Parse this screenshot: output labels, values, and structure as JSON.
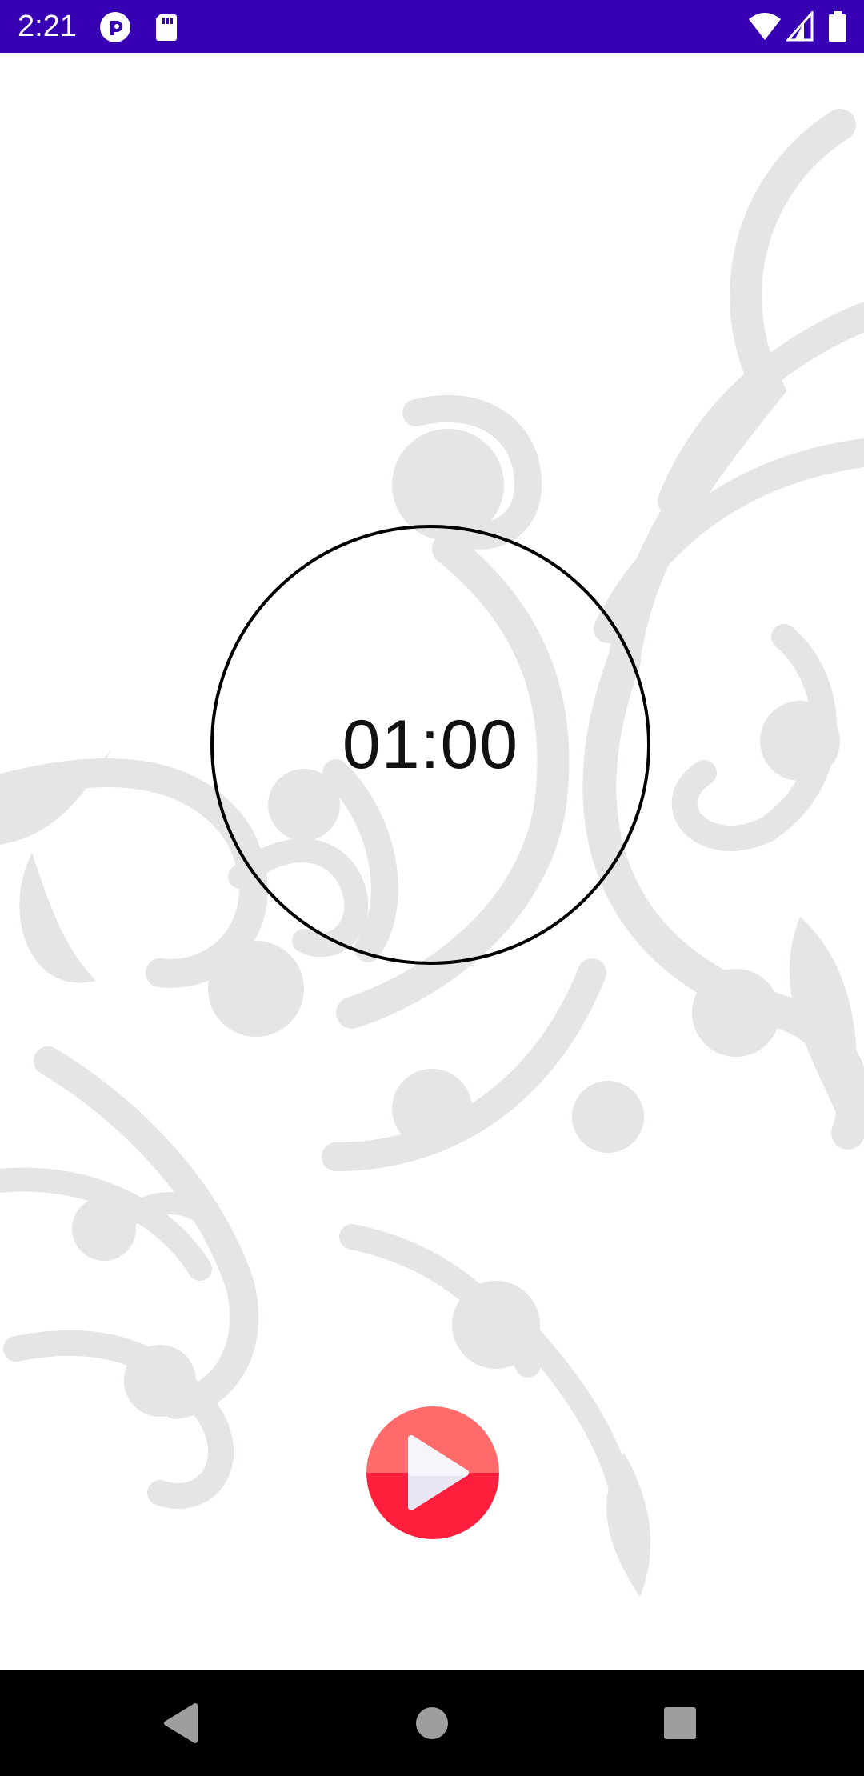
{
  "status_bar": {
    "time": "2:21",
    "left_icons": [
      "pocket-casts-icon",
      "sd-card-icon"
    ],
    "right_icons": [
      "wifi-icon",
      "cellular-signal-icon",
      "battery-icon"
    ],
    "background_color": "#3700b3"
  },
  "main": {
    "background_pattern": "floral-ornament",
    "timer": {
      "display": "01:00"
    },
    "play_button": {
      "icon": "play-icon",
      "color_top": "#ff6b6b",
      "color_bottom": "#ff1f3d"
    }
  },
  "nav_bar": {
    "buttons": [
      "back-icon",
      "home-icon",
      "recents-icon"
    ]
  }
}
